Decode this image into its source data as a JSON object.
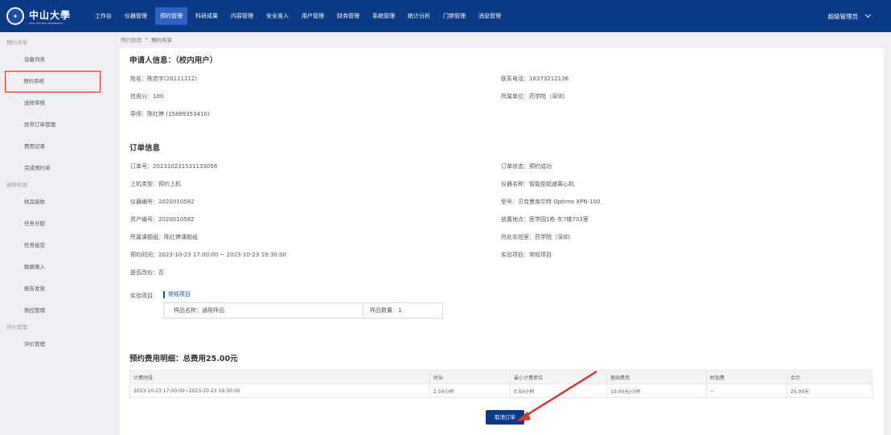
{
  "app": {
    "logo_name": "中山大學",
    "logo_sub": "SUN YAT-SEN UNIVERSITY",
    "nav": [
      "工作台",
      "仪器管理",
      "预约管理",
      "科研成果",
      "内容管理",
      "安全准入",
      "用户管理",
      "财务管理",
      "系统管理",
      "统计分析",
      "门禁管理",
      "消息管理"
    ],
    "user": "超级管理员"
  },
  "sidebar": {
    "g1": "预约共享",
    "i1": "设备列表",
    "i2": "预约审核",
    "i3": "送样审核",
    "i4": "异常订单管理",
    "i5": "费用记录",
    "i6": "完成预约单",
    "g2": "送样检测",
    "i7": "样品接收",
    "i8": "任务分配",
    "i9": "任务接受",
    "i10": "数据录入",
    "i11": "报告发放",
    "i12": "质控管理",
    "g3": "评价管理",
    "i13": "评价管理"
  },
  "breadcrumb": {
    "parent": "预约管理",
    "sep": "»",
    "current": "预约共享"
  },
  "applicant": {
    "title": "申请人信息：（校内用户）",
    "name": "姓名：陈杏宇(20111212)",
    "phone": "联系电话：18373212136",
    "credit": "信用分：100",
    "unit": "所属单位：药学院（深圳）",
    "mentor": "导师：陈红婷 (15889353410)"
  },
  "order": {
    "title": "订单信息",
    "no": "订单号：202310231531133056",
    "status": "订单状态：预约成功",
    "type": "上机类型：预约上机",
    "instrument": "仪器名称：智能型超速离心机",
    "inst_no": "仪器编号：2020010582",
    "model": "型号：贝克曼库尔特 Optima XPN-100",
    "asset": "资产编号：2020010582",
    "location": "放置地点：医学园1栋-东7楼703室",
    "group": "所属课题组：陈红婷课题组",
    "lab": "所处实验室：药学院（深圳）",
    "time": "预约时间：2023-10-23 17:00:00 ~ 2023-10-23 19:30:00",
    "project": "实验项目：常规项目",
    "discount": "是否改价：否",
    "proj_label": "实验项目：",
    "proj_tag": "常规项目",
    "sample_name": "样品名称：通用样品",
    "sample_count": "样品数量：1"
  },
  "fee": {
    "title": "预约费用明细：总费用25.00元",
    "headers": [
      "计费时段",
      "时长",
      "最小计费单位",
      "基础费用",
      "附加费",
      "合计"
    ],
    "row": [
      "2023-10-23 17:00:00~2023-10-23 19:30:00",
      "2.50小时",
      "0.50小时",
      "10.00元/小时",
      "--",
      "25.00元"
    ]
  },
  "actions": {
    "cancel": "取消订单"
  },
  "colors": {
    "nav_bg": "#0d3a87",
    "highlight": "#e0302a",
    "accent": "#1b4fa8"
  }
}
